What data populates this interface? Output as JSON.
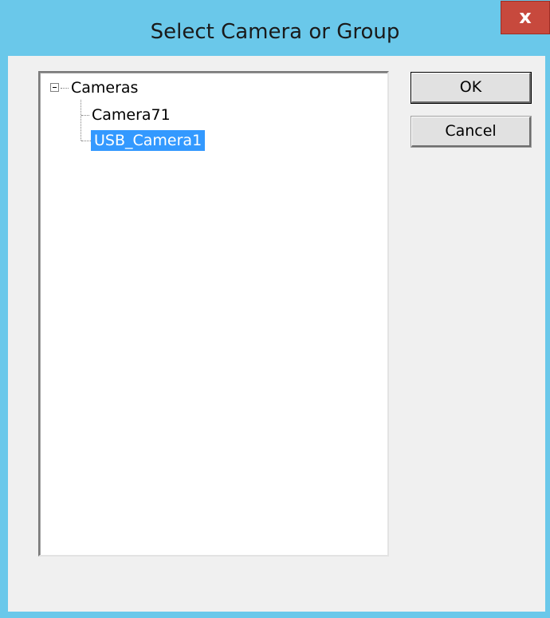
{
  "window": {
    "title": "Select Camera or Group",
    "close_glyph": "x"
  },
  "tree": {
    "root_label": "Cameras",
    "root_expander": "minus-box-icon",
    "children": [
      {
        "label": "Camera71",
        "selected": false
      },
      {
        "label": "USB_Camera1",
        "selected": true
      }
    ]
  },
  "buttons": {
    "ok_label": "OK",
    "cancel_label": "Cancel"
  },
  "colors": {
    "title_bar": "#6ac8ea",
    "close_button": "#c7493d",
    "selection": "#3399ff",
    "dialog_face": "#f0f0f0"
  }
}
